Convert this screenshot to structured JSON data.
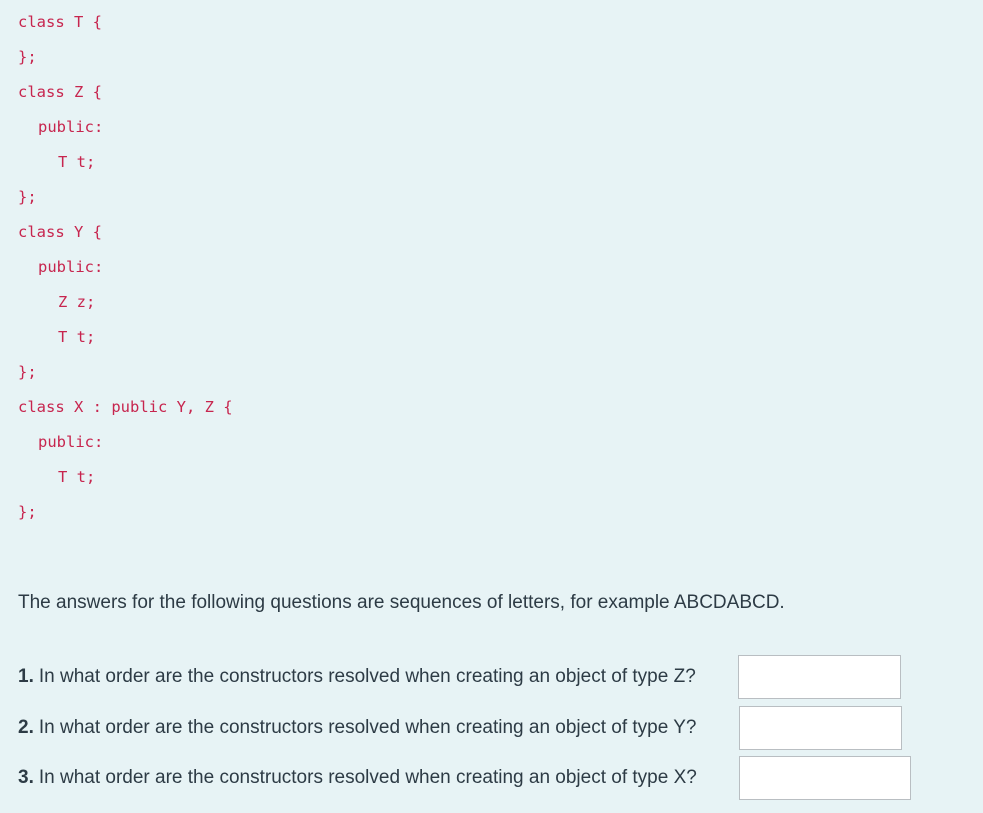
{
  "code_lines": [
    {
      "text": "class T {",
      "indent": 0
    },
    {
      "text": "};",
      "indent": 0
    },
    {
      "text": "class Z {",
      "indent": 0
    },
    {
      "text": "public:",
      "indent": 1
    },
    {
      "text": "T t;",
      "indent": 2
    },
    {
      "text": "};",
      "indent": 0
    },
    {
      "text": "class Y {",
      "indent": 0
    },
    {
      "text": "public:",
      "indent": 1
    },
    {
      "text": "Z z;",
      "indent": 2
    },
    {
      "text": "T t;",
      "indent": 2
    },
    {
      "text": "};",
      "indent": 0
    },
    {
      "text": "class X : public Y, Z {",
      "indent": 0
    },
    {
      "text": "public:",
      "indent": 1
    },
    {
      "text": "T t;",
      "indent": 2
    },
    {
      "text": "};",
      "indent": 0
    }
  ],
  "intro": "The answers for the following questions are sequences of letters, for example ABCDABCD.",
  "questions": [
    {
      "number": "1.",
      "text": "In what order are the constructors resolved when creating an object of type Z?",
      "answer": ""
    },
    {
      "number": "2.",
      "text": "In what order are the constructors resolved when creating an object of type Y?",
      "answer": ""
    },
    {
      "number": "3.",
      "text": "In what order are the constructors resolved when creating an object of type X?",
      "answer": ""
    }
  ],
  "colors": {
    "background": "#e7f3f5",
    "code_text": "#c7254e",
    "body_text": "#2d3b45",
    "input_border": "#b9bec2"
  }
}
